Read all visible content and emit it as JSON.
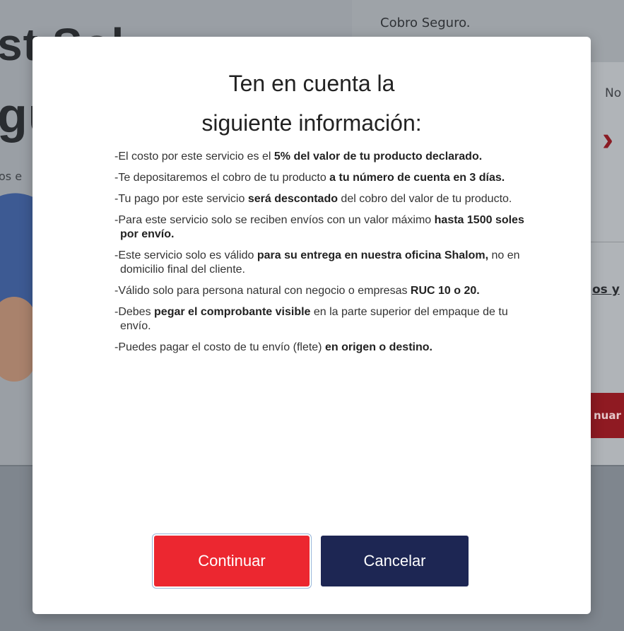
{
  "background": {
    "hero_line1": "st   Sol",
    "hero_line2": "gu",
    "hero_sub": "os e",
    "secure_label": "Cobro Seguro.",
    "right_label": "No",
    "right_chevron": "›",
    "link_text": "os y",
    "red_button_label": "nuar"
  },
  "modal": {
    "title_line1": "Ten en cuenta la",
    "title_line2": "siguiente información:",
    "items": [
      {
        "pre": "-El costo por este servicio es el ",
        "bold": "5% del valor de tu producto declarado.",
        "post": ""
      },
      {
        "pre": "-Te depositaremos el cobro de tu producto ",
        "bold": "a tu número de cuenta en 3 días.",
        "post": ""
      },
      {
        "pre": "-Tu pago por este servicio ",
        "bold": "será descontado",
        "post": " del cobro del valor de tu producto."
      },
      {
        "pre": "-Para este servicio solo se reciben envíos con un valor máximo ",
        "bold": "hasta 1500 soles por envío.",
        "post": ""
      },
      {
        "pre": "-Este servicio solo es válido ",
        "bold": "para su entrega en nuestra oficina Shalom,",
        "post": " no en domicilio final del cliente."
      },
      {
        "pre": "-Válido solo para persona natural con negocio o empresas ",
        "bold": "RUC 10 o 20.",
        "post": ""
      },
      {
        "pre": "-Debes ",
        "bold": "pegar el comprobante visible",
        "post": " en la parte superior del empaque de tu envío."
      },
      {
        "pre": "-Puedes pagar el costo de tu envío (flete) ",
        "bold": "en origen o destino.",
        "post": ""
      }
    ],
    "continue_label": "Continuar",
    "cancel_label": "Cancelar"
  },
  "colors": {
    "continue_bg": "#ec2730",
    "cancel_bg": "#1d2653"
  }
}
